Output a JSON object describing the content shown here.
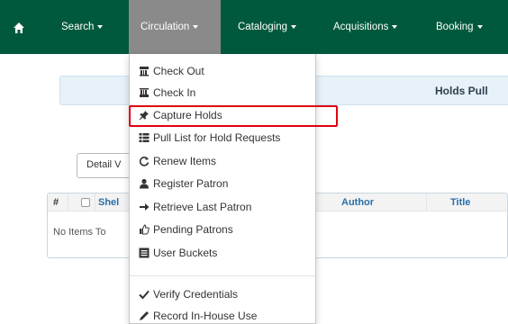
{
  "navbar": {
    "home_icon": "home-icon",
    "search_label": "Search",
    "circulation_label": "Circulation",
    "cataloging_label": "Cataloging",
    "acquisitions_label": "Acquisitions",
    "booking_label": "Booking",
    "bg_color": "#00593d",
    "active_color": "#8a8a8a"
  },
  "page": {
    "holds_title": "Holds Pull",
    "detail_button": "Detail V",
    "table": {
      "col_num": "#",
      "col_shelf": "Shel",
      "col_author": "Author",
      "col_title": "Title",
      "empty_text": "No Items To"
    }
  },
  "circulation_menu": {
    "items": [
      {
        "label": "Check Out",
        "icon": "barcode-checkout-icon"
      },
      {
        "label": "Check In",
        "icon": "barcode-checkin-icon"
      },
      {
        "label": "Capture Holds",
        "icon": "pushpin-icon",
        "highlighted": true
      },
      {
        "label": "Pull List for Hold Requests",
        "icon": "list-icon"
      },
      {
        "label": "Renew Items",
        "icon": "refresh-icon"
      },
      {
        "label": "Register Patron",
        "icon": "user-icon"
      },
      {
        "label": "Retrieve Last Patron",
        "icon": "arrow-right-icon"
      },
      {
        "label": "Pending Patrons",
        "icon": "thumbs-up-icon"
      },
      {
        "label": "User Buckets",
        "icon": "bucket-list-icon"
      },
      {
        "label": "Verify Credentials",
        "icon": "checkmark-icon"
      },
      {
        "label": "Record In-House Use",
        "icon": "pencil-icon"
      }
    ],
    "highlight_color": "#e00010"
  }
}
